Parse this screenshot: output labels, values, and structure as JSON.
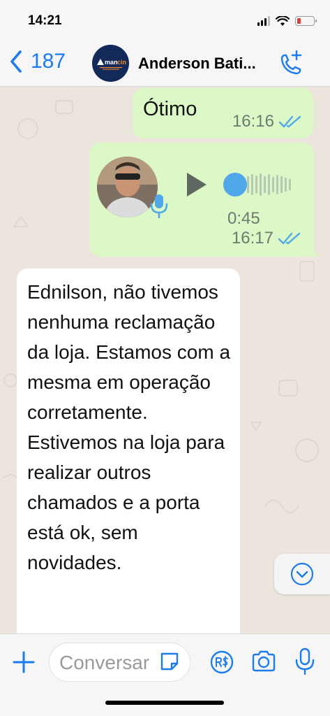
{
  "status_bar": {
    "time": "14:21"
  },
  "header": {
    "back_count": "187",
    "contact_name": "Anderson Bati...",
    "avatar_logo": "mancing"
  },
  "messages": [
    {
      "direction": "outgoing",
      "type": "text",
      "text": "Ótimo",
      "time": "16:16",
      "status": "read"
    },
    {
      "direction": "outgoing",
      "type": "voice",
      "duration": "0:45",
      "time": "16:17",
      "status": "read"
    },
    {
      "direction": "incoming",
      "type": "text",
      "text": "Ednilson, não tivemos nenhuma reclamação da loja. Estamos com a mesma em operação corretamente. Estivemos na loja para realizar outros chamados e a porta está ok, sem novidades."
    }
  ],
  "input": {
    "placeholder": "Conversar"
  },
  "icons": {
    "back": "chevron-left-icon",
    "add_call": "phone-plus-icon",
    "attach": "plus-icon",
    "sticker": "sticker-icon",
    "payment": "real-currency-icon",
    "camera": "camera-icon",
    "mic": "microphone-icon",
    "scroll_down": "chevron-down-circle-icon"
  },
  "colors": {
    "accent": "#1a7cf0",
    "outgoing_bubble": "#dcf8c6",
    "incoming_bubble": "#ffffff",
    "chat_bg": "#ece5dd",
    "read_tick": "#4fa8ea",
    "voice_dot": "#4fa8ea"
  }
}
